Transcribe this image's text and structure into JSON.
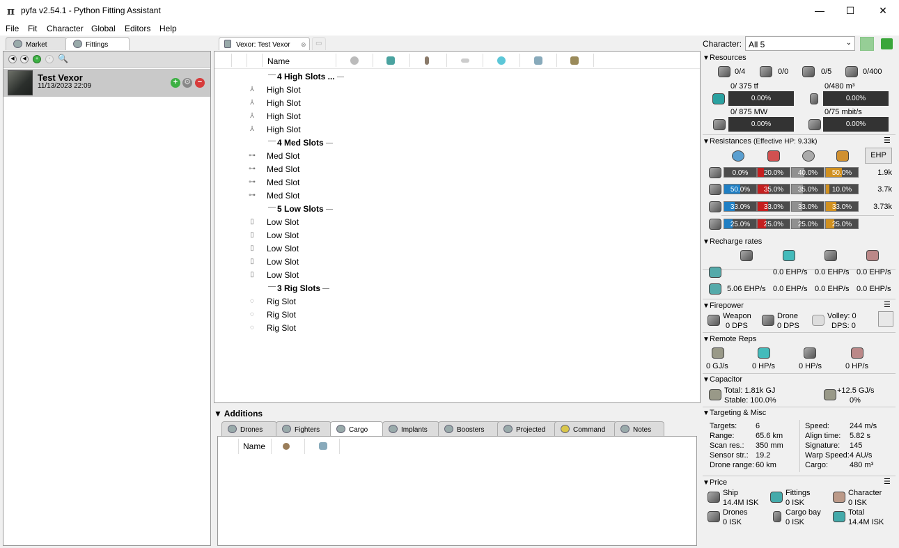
{
  "window": {
    "title": "pyfa v2.54.1 - Python Fitting Assistant",
    "logo_glyph": "π",
    "minimize": "—",
    "maximize": "☐",
    "close": "✕"
  },
  "menu": [
    "File",
    "Fit",
    "Character",
    "Global",
    "Editors",
    "Help"
  ],
  "left": {
    "tabs": [
      "Market",
      "Fittings"
    ],
    "fit": {
      "name": "Test Vexor",
      "date": "11/13/2023 22:09"
    }
  },
  "center": {
    "tab": "Vexor: Test Vexor",
    "col_name": "Name",
    "rows": [
      {
        "type": "header",
        "label": "4 High Slots ..."
      },
      {
        "type": "high",
        "label": "High Slot"
      },
      {
        "type": "high",
        "label": "High Slot"
      },
      {
        "type": "high",
        "label": "High Slot"
      },
      {
        "type": "high",
        "label": "High Slot"
      },
      {
        "type": "header",
        "label": "4 Med Slots"
      },
      {
        "type": "med",
        "label": "Med Slot"
      },
      {
        "type": "med",
        "label": "Med Slot"
      },
      {
        "type": "med",
        "label": "Med Slot"
      },
      {
        "type": "med",
        "label": "Med Slot"
      },
      {
        "type": "header",
        "label": "5 Low Slots"
      },
      {
        "type": "low",
        "label": "Low Slot"
      },
      {
        "type": "low",
        "label": "Low Slot"
      },
      {
        "type": "low",
        "label": "Low Slot"
      },
      {
        "type": "low",
        "label": "Low Slot"
      },
      {
        "type": "low",
        "label": "Low Slot"
      },
      {
        "type": "header",
        "label": "3 Rig Slots"
      },
      {
        "type": "rig",
        "label": "Rig Slot"
      },
      {
        "type": "rig",
        "label": "Rig Slot"
      },
      {
        "type": "rig",
        "label": "Rig Slot"
      }
    ]
  },
  "additions": {
    "title": "Additions",
    "tabs": [
      "Drones",
      "Fighters",
      "Cargo",
      "Implants",
      "Boosters",
      "Projected",
      "Command",
      "Notes"
    ],
    "active_tab": "Cargo",
    "col_name": "Name"
  },
  "right": {
    "character_label": "Character:",
    "character_value": "All 5",
    "resources": {
      "title": "Resources",
      "hardpoints": [
        "0/4",
        "0/0",
        "0/5",
        "0/400"
      ],
      "cpu": {
        "label": "0/ 375 tf",
        "pct": "0.00%"
      },
      "cargo": {
        "label": "0/480 m³",
        "pct": "0.00%"
      },
      "power": {
        "label": "0/ 875 MW",
        "pct": "0.00%"
      },
      "bandwidth": {
        "label": "0/75 mbit/s",
        "pct": "0.00%"
      }
    },
    "resistances": {
      "title": "Resistances",
      "ehp_text": "(Effective HP: 9.33k)",
      "ehp_button": "EHP",
      "rows": [
        {
          "vals": [
            "0.0%",
            "20.0%",
            "40.0%",
            "50.0%"
          ],
          "fills": [
            0.0,
            0.2,
            0.4,
            0.5
          ],
          "hp": "1.9k"
        },
        {
          "vals": [
            "50.0%",
            "35.0%",
            "35.0%",
            "10.0%"
          ],
          "fills": [
            0.5,
            0.35,
            0.35,
            0.1
          ],
          "hp": "3.7k"
        },
        {
          "vals": [
            "33.0%",
            "33.0%",
            "33.0%",
            "33.0%"
          ],
          "fills": [
            0.33,
            0.33,
            0.33,
            0.33
          ],
          "hp": "3.73k"
        },
        {
          "vals": [
            "25.0%",
            "25.0%",
            "25.0%",
            "25.0%"
          ],
          "fills": [
            0.25,
            0.25,
            0.25,
            0.25
          ],
          "hp": ""
        }
      ],
      "colors": [
        "#1f7fc4",
        "#c41f1f",
        "#909090",
        "#d09020"
      ]
    },
    "recharge": {
      "title": "Recharge rates",
      "row1": [
        "0.0 EHP/s",
        "0.0 EHP/s",
        "0.0 EHP/s"
      ],
      "row2": [
        "5.06 EHP/s",
        "0.0 EHP/s",
        "0.0 EHP/s",
        "0.0 EHP/s"
      ]
    },
    "firepower": {
      "title": "Firepower",
      "weapon": "Weapon",
      "weapon_dps": "0 DPS",
      "drone": "Drone",
      "drone_dps": "0 DPS",
      "volley": "Volley: 0",
      "dps": "DPS: 0"
    },
    "remote_reps": {
      "title": "Remote Reps",
      "vals": [
        "0 GJ/s",
        "0 HP/s",
        "0 HP/s",
        "0 HP/s"
      ]
    },
    "capacitor": {
      "title": "Capacitor",
      "total": "Total: 1.81k GJ",
      "stable": "Stable: 100.0%",
      "rate": "+12.5 GJ/s",
      "rate_pct": "0%"
    },
    "targeting": {
      "title": "Targeting & Misc",
      "left": [
        [
          "Targets:",
          "6"
        ],
        [
          "Range:",
          "65.6 km"
        ],
        [
          "Scan res.:",
          "350 mm"
        ],
        [
          "Sensor str.:",
          "19.2"
        ],
        [
          "Drone range:",
          "60 km"
        ]
      ],
      "right": [
        [
          "Speed:",
          "244 m/s"
        ],
        [
          "Align time:",
          "5.82 s"
        ],
        [
          "Signature:",
          "145"
        ],
        [
          "Warp Speed:",
          "4 AU/s"
        ],
        [
          "Cargo:",
          "480 m³"
        ]
      ]
    },
    "price": {
      "title": "Price",
      "items": [
        [
          "Ship",
          "14.4M ISK"
        ],
        [
          "Fittings",
          "0 ISK"
        ],
        [
          "Character",
          "0 ISK"
        ],
        [
          "Drones",
          "0 ISK"
        ],
        [
          "Cargo bay",
          "0 ISK"
        ],
        [
          "Total",
          "14.4M ISK"
        ]
      ]
    }
  }
}
